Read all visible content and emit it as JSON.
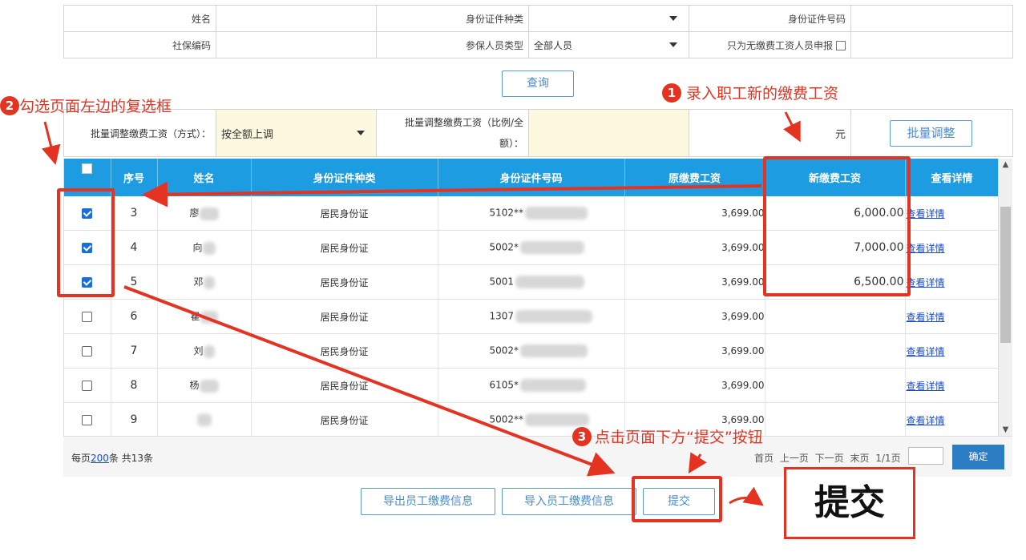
{
  "form": {
    "name_label": "姓名",
    "id_type_label": "身份证件种类",
    "id_no_label": "身份证件号码",
    "ss_code_label": "社保编码",
    "insured_type_label": "参保人员类型",
    "insured_type_value": "全部人员",
    "only_no_wage_label": "只为无缴费工资人员申报"
  },
  "query_button": "查询",
  "batch": {
    "method_label": "批量调整缴费工资（方式）：",
    "method_value": "按全额上调",
    "amount_label_line1": "批量调整缴费工资（比例/全",
    "amount_label_line2": "额）：",
    "unit": "元",
    "adjust_button": "批量调整"
  },
  "table": {
    "headers": [
      "序号",
      "姓名",
      "身份证件种类",
      "身份证件号码",
      "原缴费工资",
      "新缴费工资",
      "查看详情"
    ],
    "rows": [
      {
        "seq": "3",
        "name": "廖",
        "id_type": "居民身份证",
        "id_no": "5102**",
        "old_wage": "3,699.00",
        "new_wage": "6,000.00",
        "detail": "查看详情",
        "checked": true
      },
      {
        "seq": "4",
        "name": "向",
        "id_type": "居民身份证",
        "id_no": "5002*",
        "old_wage": "3,699.00",
        "new_wage": "7,000.00",
        "detail": "查看详情",
        "checked": true
      },
      {
        "seq": "5",
        "name": "邓",
        "id_type": "居民身份证",
        "id_no": "5001",
        "old_wage": "3,699.00",
        "new_wage": "6,500.00",
        "detail": "查看详情",
        "checked": true
      },
      {
        "seq": "6",
        "name": "瞿",
        "id_type": "居民身份证",
        "id_no": "1307",
        "old_wage": "3,699.00",
        "new_wage": "",
        "detail": "查看详情",
        "checked": false
      },
      {
        "seq": "7",
        "name": "刘",
        "id_type": "居民身份证",
        "id_no": "5002*",
        "old_wage": "3,699.00",
        "new_wage": "",
        "detail": "查看详情",
        "checked": false
      },
      {
        "seq": "8",
        "name": "杨",
        "id_type": "居民身份证",
        "id_no": "6105*",
        "old_wage": "3,699.00",
        "new_wage": "",
        "detail": "查看详情",
        "checked": false
      },
      {
        "seq": "9",
        "name": "",
        "id_type": "居民身份证",
        "id_no": "5002**",
        "old_wage": "3,699.00",
        "new_wage": "",
        "detail": "查看详情",
        "checked": false
      }
    ]
  },
  "pager": {
    "per_page_prefix": "每页",
    "per_page_value": "200",
    "per_page_suffix": "条 共13条",
    "nav": "首页 上一页 下一页 末页 1/1页",
    "confirm": "确定"
  },
  "bottom_buttons": {
    "export": "导出员工缴费信息",
    "import": "导入员工缴费信息",
    "submit": "提交"
  },
  "annotations": {
    "step1_num": "1",
    "step1_text": "录入职工新的缴费工资",
    "step2_num": "2",
    "step2_text": "勾选页面左边的复选框",
    "step3_num": "3",
    "step3_text": "点击页面下方“提交”按钮",
    "big_submit": "提交"
  },
  "colors": {
    "header_blue": "#1d9ce2",
    "annotation_red": "#e53322",
    "checkbox_blue": "#1a6fd6"
  }
}
